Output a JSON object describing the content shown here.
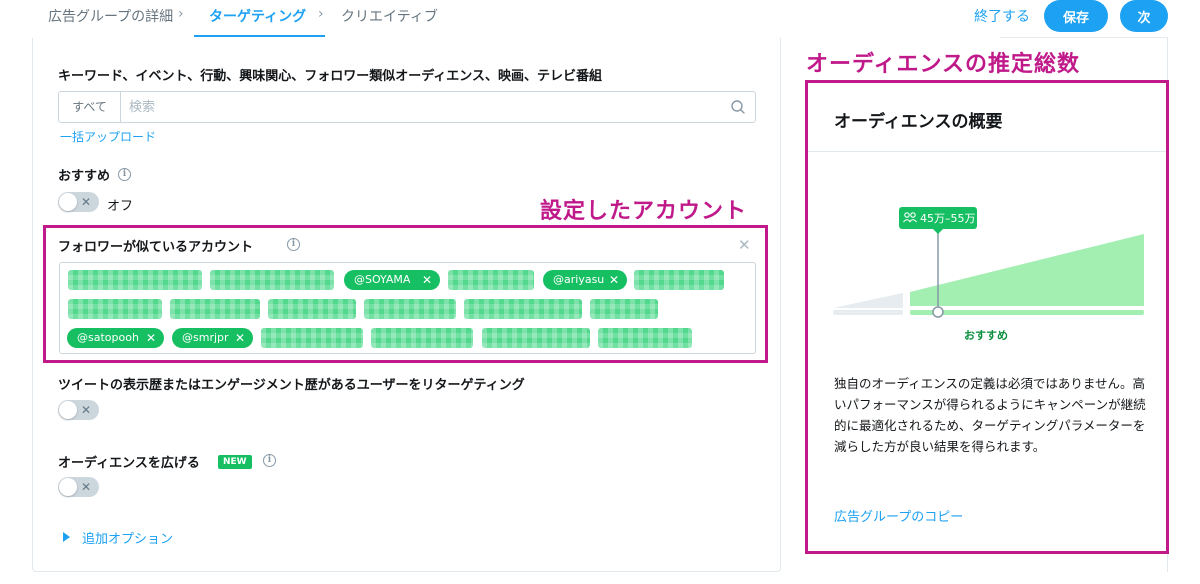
{
  "nav": {
    "steps": [
      "広告グループの詳細",
      "ターゲティング",
      "クリエイティブ"
    ],
    "finish_label": "終了する",
    "save_label": "保存",
    "next_label": "次"
  },
  "keywords": {
    "title": "キーワード、イベント、行動、興味関心、フォロワー類似オーディエンス、映画、テレビ番組",
    "scope": "すべて",
    "placeholder": "検索",
    "bulk_upload": "一括アップロード"
  },
  "recommended": {
    "title": "おすすめ",
    "state_label": "オフ"
  },
  "annotations": {
    "accounts": "設定したアカウント",
    "audience": "オーディエンスの推定総数"
  },
  "follower_lookalike": {
    "title": "フォロワーが似ているアカウント",
    "chips": [
      "@SOYAMA",
      "@ariyasu",
      "@satopooh",
      "@smrjpr"
    ]
  },
  "retargeting": {
    "title": "ツイートの表示歴またはエンゲージメント歴があるユーザーをリターゲティング"
  },
  "expand": {
    "title": "オーディエンスを広げる",
    "badge": "NEW"
  },
  "more_options": "追加オプション",
  "audience_summary": {
    "title": "オーディエンスの概要",
    "estimate": "45万–55万",
    "recommended_label": "おすすめ",
    "description": "独自のオーディエンスの定義は必須ではありません。高いパフォーマンスが得られるようにキャンペーンが継続的に最適化されるため、ターゲティングパラメーターを減らした方が良い結果を得られます。",
    "copy_link": "広告グループのコピー"
  },
  "colors": {
    "accent": "#1da1f2",
    "green": "#17bf63",
    "annotation": "#c0198a"
  }
}
